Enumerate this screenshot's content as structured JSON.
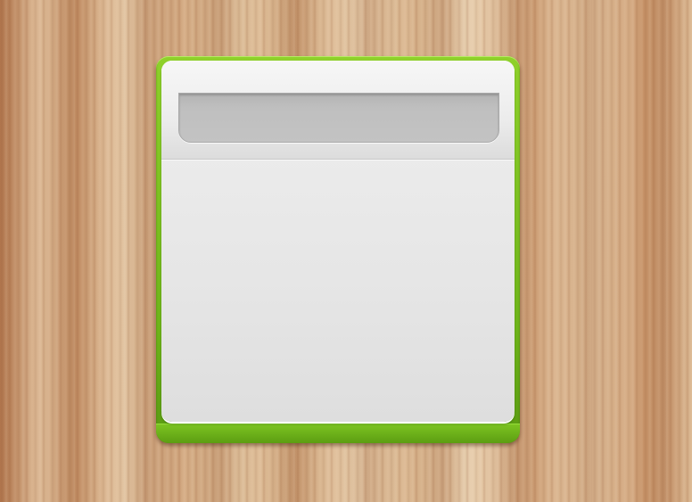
{
  "widget": {
    "accent_color": "#7cc21f",
    "panel_color": "#e9e9e9",
    "search": {
      "value": "",
      "placeholder": ""
    },
    "content_items": []
  }
}
